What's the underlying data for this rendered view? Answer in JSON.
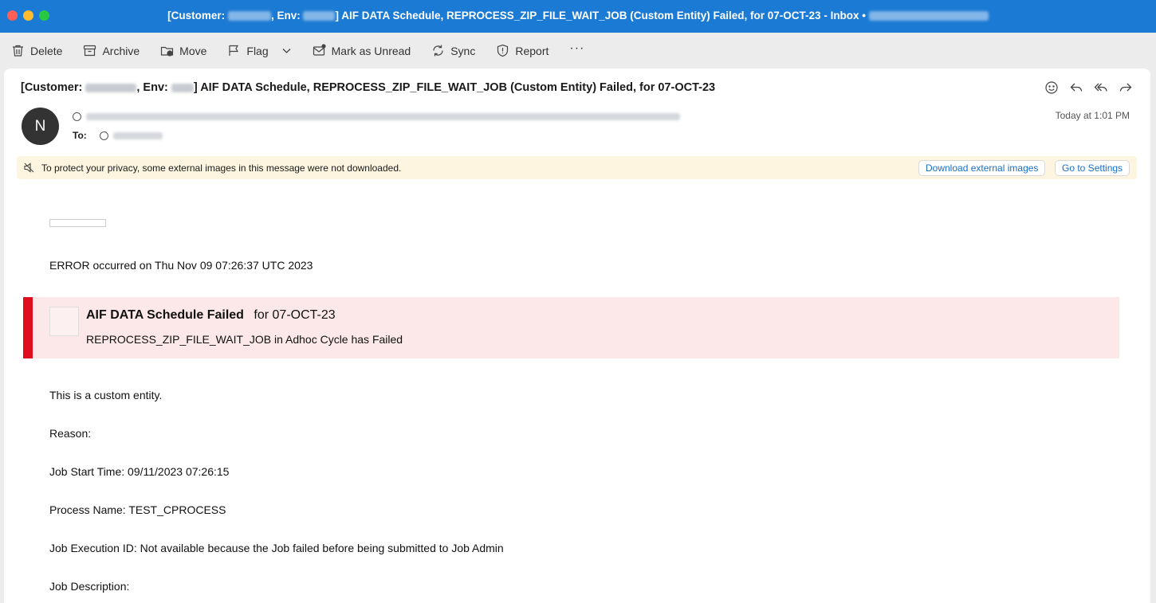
{
  "window": {
    "title_prefix": "[Customer:",
    "title_env": ", Env:",
    "title_rest": "] AIF DATA Schedule, REPROCESS_ZIP_FILE_WAIT_JOB (Custom Entity) Failed, for 07-OCT-23 - Inbox •"
  },
  "toolbar": {
    "delete": "Delete",
    "archive": "Archive",
    "move": "Move",
    "flag": "Flag",
    "mark_unread": "Mark as Unread",
    "sync": "Sync",
    "report": "Report",
    "more": "···"
  },
  "message": {
    "subject_prefix": "[Customer:",
    "subject_env": ", Env:",
    "subject_rest": "] AIF DATA Schedule, REPROCESS_ZIP_FILE_WAIT_JOB (Custom Entity) Failed, for 07-OCT-23",
    "avatar_initial": "N",
    "to_label": "To:",
    "timestamp": "Today at 1:01 PM"
  },
  "privacy_banner": {
    "text": "To protect your privacy, some external images in this message were not downloaded.",
    "download_label": "Download external images",
    "settings_label": "Go to Settings"
  },
  "email_body": {
    "error_line": "ERROR occurred on Thu Nov 09 07:26:37 UTC 2023",
    "alert_title": "AIF DATA Schedule Failed",
    "alert_for": "for 07-OCT-23",
    "alert_sub": "REPROCESS_ZIP_FILE_WAIT_JOB in Adhoc Cycle has Failed",
    "custom_entity": "This is a custom entity.",
    "reason": "Reason:",
    "job_start": "Job Start Time: 09/11/2023 07:26:15",
    "process_name": "Process Name: TEST_CPROCESS",
    "job_exec": "Job Execution ID: Not available because the Job failed before being submitted to Job Admin",
    "job_desc": "Job Description:"
  },
  "colors": {
    "titlebar": "#1b7ad4",
    "alert_bar": "#e00d1f",
    "alert_bg": "#fce8e8",
    "banner_bg": "#fdf5df",
    "link": "#1a6fc4"
  }
}
